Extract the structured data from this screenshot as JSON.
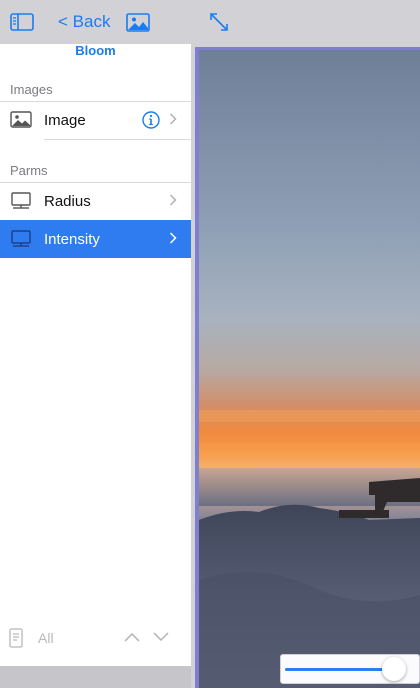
{
  "toolbar": {
    "back_label": "< Back",
    "sidebar_icon": "sidebar-toggle-icon",
    "image_icon": "photo-icon",
    "expand_icon": "expand-arrows-icon"
  },
  "sidebar": {
    "title": "Bloom",
    "sections": {
      "images": {
        "header": "Images",
        "items": [
          {
            "label": "Image",
            "icon": "image-icon",
            "has_info": true
          }
        ]
      },
      "parms": {
        "header": "Parms",
        "items": [
          {
            "label": "Radius",
            "icon": "monitor-icon",
            "selected": false
          },
          {
            "label": "Intensity",
            "icon": "monitor-icon",
            "selected": true
          }
        ]
      }
    },
    "footer": {
      "filter_label": "All"
    }
  },
  "slider": {
    "value": 0.92
  },
  "colors": {
    "accent": "#1a7cf2",
    "selection": "#2f7bf0",
    "frame": "#7f7fcf"
  }
}
